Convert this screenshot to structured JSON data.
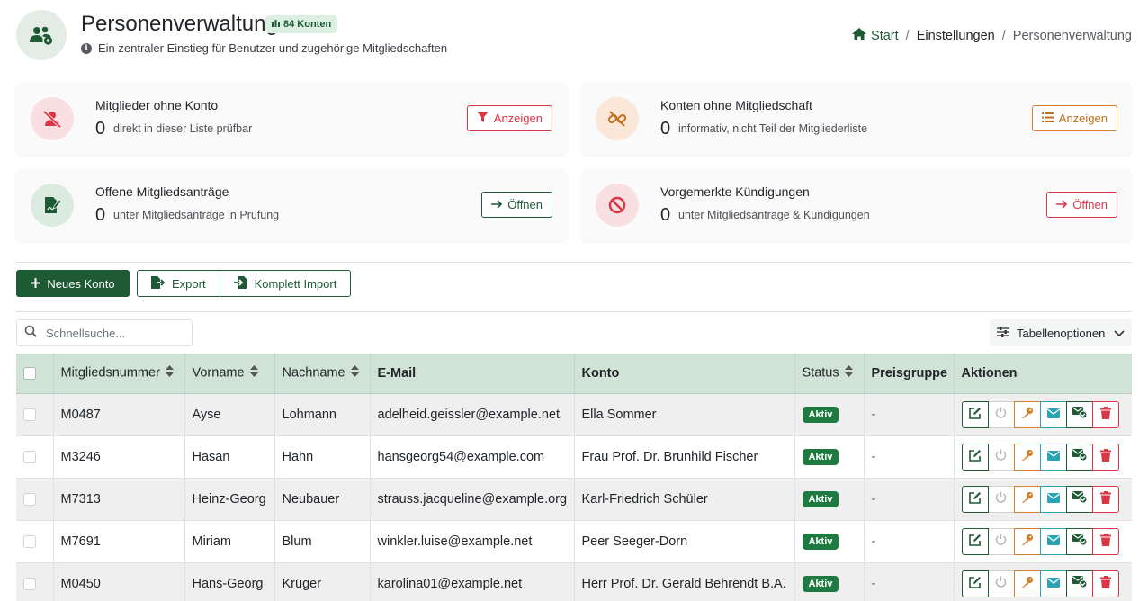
{
  "header": {
    "title": "Personenverwaltung",
    "count_badge": "84 Konten",
    "subtitle": "Ein zentraler Einstieg für Benutzer und zugehörige Mitgliedschaften"
  },
  "breadcrumb": {
    "home": "Start",
    "middle": "Einstellungen",
    "current": "Personenverwaltung"
  },
  "cards": [
    {
      "title": "Mitglieder ohne Konto",
      "count": "0",
      "desc": "direkt in dieser Liste prüfbar",
      "button": "Anzeigen"
    },
    {
      "title": "Konten ohne Mitgliedschaft",
      "count": "0",
      "desc": "informativ, nicht Teil der Mitgliederliste",
      "button": "Anzeigen"
    },
    {
      "title": "Offene Mitgliedsanträge",
      "count": "0",
      "desc": "unter Mitgliedsanträge in Prüfung",
      "button": "Öffnen"
    },
    {
      "title": "Vorgemerkte Kündigungen",
      "count": "0",
      "desc": "unter Mitgliedsanträge & Kündigungen",
      "button": "Öffnen"
    }
  ],
  "toolbar": {
    "new_account": "Neues Konto",
    "export": "Export",
    "import": "Komplett Import"
  },
  "search": {
    "placeholder": "Schnellsuche..."
  },
  "table_options": "Tabellenoptionen",
  "table": {
    "columns": [
      "Mitgliedsnummer",
      "Vorname",
      "Nachname",
      "E-Mail",
      "Konto",
      "Status",
      "Preisgruppe",
      "Aktionen"
    ],
    "rows": [
      {
        "id": "M0487",
        "first": "Ayse",
        "last": "Lohmann",
        "email": "adelheid.geissler@example.net",
        "account": "Ella Sommer",
        "status": "Aktiv",
        "price": "-"
      },
      {
        "id": "M3246",
        "first": "Hasan",
        "last": "Hahn",
        "email": "hansgeorg54@example.com",
        "account": "Frau Prof. Dr. Brunhild Fischer",
        "status": "Aktiv",
        "price": "-"
      },
      {
        "id": "M7313",
        "first": "Heinz-Georg",
        "last": "Neubauer",
        "email": "strauss.jacqueline@example.org",
        "account": "Karl-Friedrich Schüler",
        "status": "Aktiv",
        "price": "-"
      },
      {
        "id": "M7691",
        "first": "Miriam",
        "last": "Blum",
        "email": "winkler.luise@example.net",
        "account": "Peer Seeger-Dorn",
        "status": "Aktiv",
        "price": "-"
      },
      {
        "id": "M0450",
        "first": "Hans-Georg",
        "last": "Krüger",
        "email": "karolina01@example.net",
        "account": "Herr Prof. Dr. Gerald Behrendt B.A.",
        "status": "Aktiv",
        "price": "-"
      }
    ]
  },
  "colors": {
    "primary": "#1e5a34",
    "danger": "#dc3545",
    "warning": "#d47f2a",
    "info": "#2aa3b5",
    "table_header": "#d1e3d6"
  },
  "icons": [
    "users-gear-icon",
    "chart-bar-icon",
    "info-icon",
    "home-icon",
    "user-slash-icon",
    "link-slash-icon",
    "file-signature-icon",
    "ban-icon",
    "filter-icon",
    "list-icon",
    "arrow-right-icon",
    "plus-icon",
    "file-export-icon",
    "file-import-icon",
    "search-icon",
    "sliders-icon",
    "chevron-down-icon",
    "sort-icon",
    "edit-icon",
    "power-icon",
    "key-icon",
    "envelope-icon",
    "envelope-check-icon",
    "trash-icon"
  ]
}
